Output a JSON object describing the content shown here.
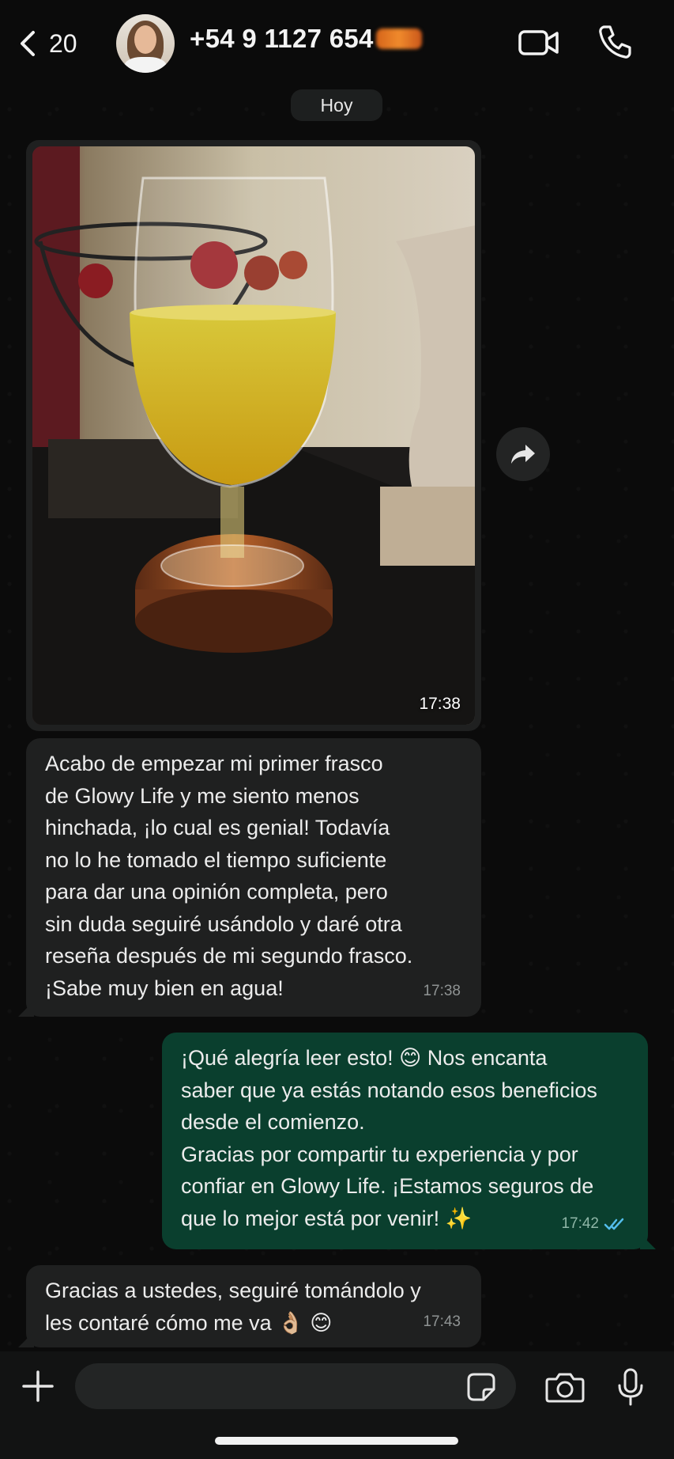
{
  "header": {
    "back_count": "20",
    "contact_number": "+54 9 1127 654",
    "contact_number_hidden": "335"
  },
  "date_chip": "Hoy",
  "messages": [
    {
      "type": "image",
      "direction": "incoming",
      "time": "17:38"
    },
    {
      "type": "text",
      "direction": "incoming",
      "text": "Acabo de empezar mi primer frasco\nde Glowy Life y me siento menos\nhinchada, ¡lo cual es genial! Todavía\nno lo he tomado el tiempo suficiente\npara dar una opinión completa, pero\nsin duda seguiré usándolo y daré otra\nreseña después de mi segundo frasco.\n¡Sabe muy bien en agua!",
      "time": "17:38"
    },
    {
      "type": "text",
      "direction": "outgoing",
      "text": "¡Qué alegría leer esto! 😊 Nos encanta\nsaber que ya estás notando esos beneficios\ndesde el comienzo.\nGracias por compartir tu experiencia y por\nconfiar en Glowy Life. ¡Estamos seguros de\nque lo mejor está por venir! ✨",
      "time": "17:42",
      "status": "read"
    },
    {
      "type": "text",
      "direction": "incoming",
      "text": "Gracias a ustedes, seguiré tomándolo y\nles contaré cómo me va 👌🏼 😊",
      "time": "17:43"
    }
  ],
  "composer": {
    "value": "",
    "placeholder": ""
  },
  "icons": {
    "back": "chevron-left-icon",
    "video": "video-call-icon",
    "call": "phone-icon",
    "forward": "forward-icon",
    "plus": "plus-icon",
    "sticker": "sticker-icon",
    "camera": "camera-icon",
    "mic": "microphone-icon"
  },
  "colors": {
    "incoming_bubble": "#1f2020",
    "outgoing_bubble": "#0a3f2e",
    "read_tick": "#53bdeb",
    "background": "#0b0b0b"
  }
}
